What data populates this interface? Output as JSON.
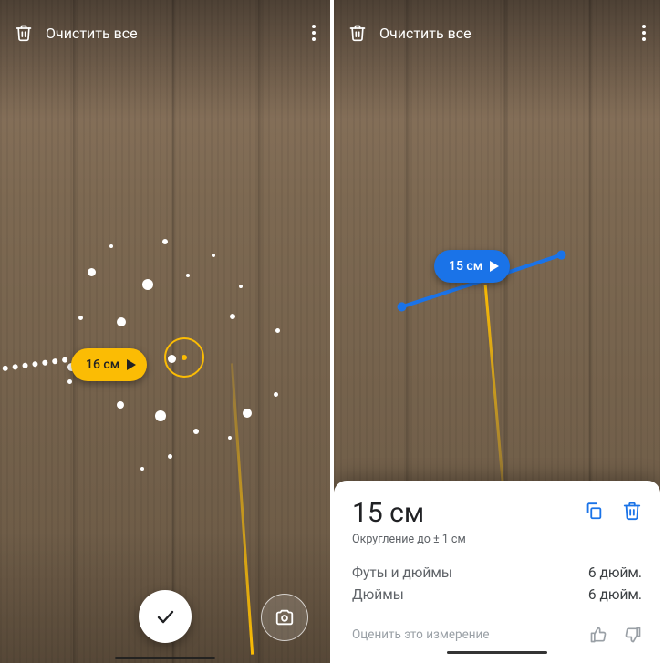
{
  "icons": {
    "trash": "trash-icon",
    "more": "more-icon",
    "check": "check-icon",
    "camera": "camera-icon",
    "play": "play-icon",
    "copy": "copy-icon",
    "thumb_up": "thumb-up-icon",
    "thumb_down": "thumb-down-icon"
  },
  "left": {
    "toolbar": {
      "clear_label": "Очистить все"
    },
    "measurement": {
      "label": "16 см"
    }
  },
  "right": {
    "toolbar": {
      "clear_label": "Очистить все"
    },
    "measurement": {
      "label": "15 см"
    },
    "sheet": {
      "value": "15 см",
      "rounding_note": "Округление до ± 1 см",
      "rows": [
        {
          "label": "Футы и дюймы",
          "value": "6 дюйм."
        },
        {
          "label": "Дюймы",
          "value": "6 дюйм."
        }
      ],
      "rate_label": "Оценить это измерение"
    }
  },
  "colors": {
    "accent_yellow": "#fbbc04",
    "accent_blue": "#1a73e8",
    "danger_blue": "#1a73e8"
  }
}
